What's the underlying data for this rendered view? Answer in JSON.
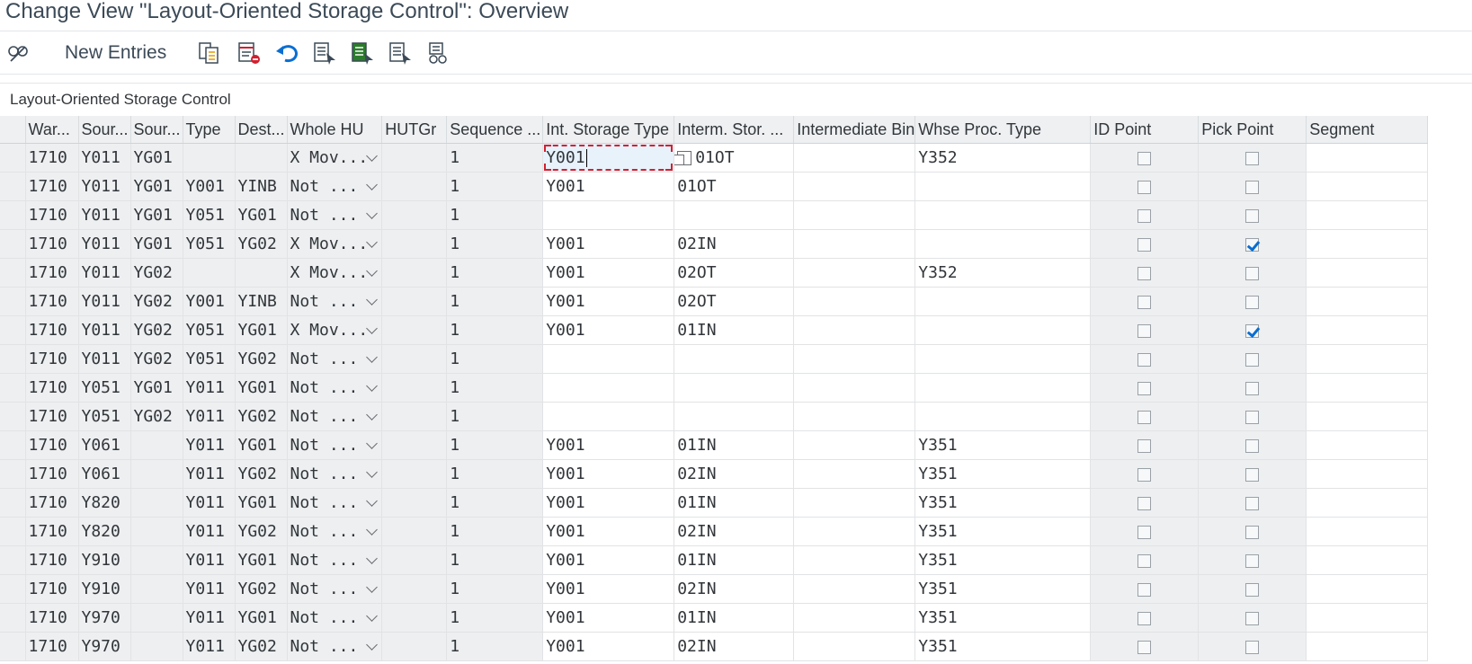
{
  "title": "Change View \"Layout-Oriented Storage Control\": Overview",
  "toolbar": {
    "new_entries_label": "New Entries",
    "icons": [
      "display-change-icon",
      "copy-icon",
      "delete-icon",
      "undo-icon",
      "select-all-icon",
      "select-block-icon",
      "deselect-all-icon",
      "print-icon"
    ]
  },
  "section_title": "Layout-Oriented Storage Control",
  "columns": [
    "War...",
    "Sour...",
    "Sour...",
    "Type",
    "Dest...",
    "Whole HU",
    "HUTGr",
    "Sequence ...",
    "Int. Storage Type",
    "Interm. Stor. ...",
    "Intermediate Bin",
    "Whse Proc. Type",
    "ID Point",
    "Pick Point",
    "Segment"
  ],
  "rows": [
    {
      "c": [
        "1710",
        "Y011",
        "YG01",
        "",
        "",
        "X Mov...",
        "",
        "1",
        "Y001",
        "01OT",
        "",
        "Y352"
      ],
      "id": false,
      "pick": false
    },
    {
      "c": [
        "1710",
        "Y011",
        "YG01",
        "Y001",
        "YINB",
        "Not ...",
        "",
        "1",
        "Y001",
        "01OT",
        "",
        ""
      ],
      "id": false,
      "pick": false
    },
    {
      "c": [
        "1710",
        "Y011",
        "YG01",
        "Y051",
        "YG01",
        "Not ...",
        "",
        "1",
        "",
        "",
        "",
        ""
      ],
      "id": false,
      "pick": false
    },
    {
      "c": [
        "1710",
        "Y011",
        "YG01",
        "Y051",
        "YG02",
        "X Mov...",
        "",
        "1",
        "Y001",
        "02IN",
        "",
        ""
      ],
      "id": false,
      "pick": true
    },
    {
      "c": [
        "1710",
        "Y011",
        "YG02",
        "",
        "",
        "X Mov...",
        "",
        "1",
        "Y001",
        "02OT",
        "",
        "Y352"
      ],
      "id": false,
      "pick": false
    },
    {
      "c": [
        "1710",
        "Y011",
        "YG02",
        "Y001",
        "YINB",
        "Not ...",
        "",
        "1",
        "Y001",
        "02OT",
        "",
        ""
      ],
      "id": false,
      "pick": false
    },
    {
      "c": [
        "1710",
        "Y011",
        "YG02",
        "Y051",
        "YG01",
        "X Mov...",
        "",
        "1",
        "Y001",
        "01IN",
        "",
        ""
      ],
      "id": false,
      "pick": true
    },
    {
      "c": [
        "1710",
        "Y011",
        "YG02",
        "Y051",
        "YG02",
        "Not ...",
        "",
        "1",
        "",
        "",
        "",
        ""
      ],
      "id": false,
      "pick": false
    },
    {
      "c": [
        "1710",
        "Y051",
        "YG01",
        "Y011",
        "YG01",
        "Not ...",
        "",
        "1",
        "",
        "",
        "",
        ""
      ],
      "id": false,
      "pick": false
    },
    {
      "c": [
        "1710",
        "Y051",
        "YG02",
        "Y011",
        "YG02",
        "Not ...",
        "",
        "1",
        "",
        "",
        "",
        ""
      ],
      "id": false,
      "pick": false
    },
    {
      "c": [
        "1710",
        "Y061",
        "",
        "Y011",
        "YG01",
        "Not ...",
        "",
        "1",
        "Y001",
        "01IN",
        "",
        "Y351"
      ],
      "id": false,
      "pick": false
    },
    {
      "c": [
        "1710",
        "Y061",
        "",
        "Y011",
        "YG02",
        "Not ...",
        "",
        "1",
        "Y001",
        "02IN",
        "",
        "Y351"
      ],
      "id": false,
      "pick": false
    },
    {
      "c": [
        "1710",
        "Y820",
        "",
        "Y011",
        "YG01",
        "Not ...",
        "",
        "1",
        "Y001",
        "01IN",
        "",
        "Y351"
      ],
      "id": false,
      "pick": false
    },
    {
      "c": [
        "1710",
        "Y820",
        "",
        "Y011",
        "YG02",
        "Not ...",
        "",
        "1",
        "Y001",
        "02IN",
        "",
        "Y351"
      ],
      "id": false,
      "pick": false
    },
    {
      "c": [
        "1710",
        "Y910",
        "",
        "Y011",
        "YG01",
        "Not ...",
        "",
        "1",
        "Y001",
        "01IN",
        "",
        "Y351"
      ],
      "id": false,
      "pick": false
    },
    {
      "c": [
        "1710",
        "Y910",
        "",
        "Y011",
        "YG02",
        "Not ...",
        "",
        "1",
        "Y001",
        "02IN",
        "",
        "Y351"
      ],
      "id": false,
      "pick": false
    },
    {
      "c": [
        "1710",
        "Y970",
        "",
        "Y011",
        "YG01",
        "Not ...",
        "",
        "1",
        "Y001",
        "01IN",
        "",
        "Y351"
      ],
      "id": false,
      "pick": false
    },
    {
      "c": [
        "1710",
        "Y970",
        "",
        "Y011",
        "YG02",
        "Not ...",
        "",
        "1",
        "Y001",
        "02IN",
        "",
        "Y351"
      ],
      "id": false,
      "pick": false
    }
  ],
  "colors": {
    "accent": "#0a6ed1",
    "focus_border": "#d32030",
    "readonly_bg": "#edeff1"
  }
}
